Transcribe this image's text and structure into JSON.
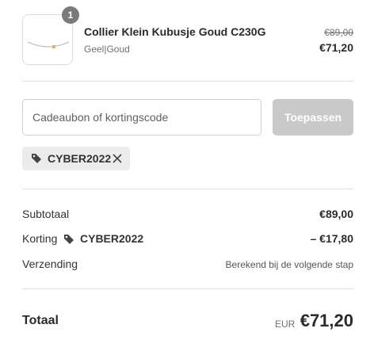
{
  "product": {
    "quantity": "1",
    "name": "Collier Klein Kubusje Goud C230G",
    "variant": "Geel|Goud",
    "original_price": "€89,00",
    "price": "€71,20"
  },
  "discount": {
    "input_placeholder": "Cadeaubon of kortingscode",
    "apply_label": "Toepassen",
    "applied_code": "CYBER2022",
    "tag_icon": "tag-icon",
    "remove_icon": "close-icon"
  },
  "summary": {
    "subtotal_label": "Subtotaal",
    "subtotal_value": "€89,00",
    "discount_label": "Korting",
    "discount_code": "CYBER2022",
    "discount_value": "– €17,80",
    "shipping_label": "Verzending",
    "shipping_value": "Berekend bij de volgende stap"
  },
  "total": {
    "label": "Totaal",
    "currency": "EUR",
    "value": "€71,20"
  },
  "colors": {
    "badge": "#7a7a7a",
    "apply_button_disabled": "#c9c9c9",
    "tag_background": "#ececec",
    "text": "#2b2b2b",
    "muted": "#707070"
  }
}
